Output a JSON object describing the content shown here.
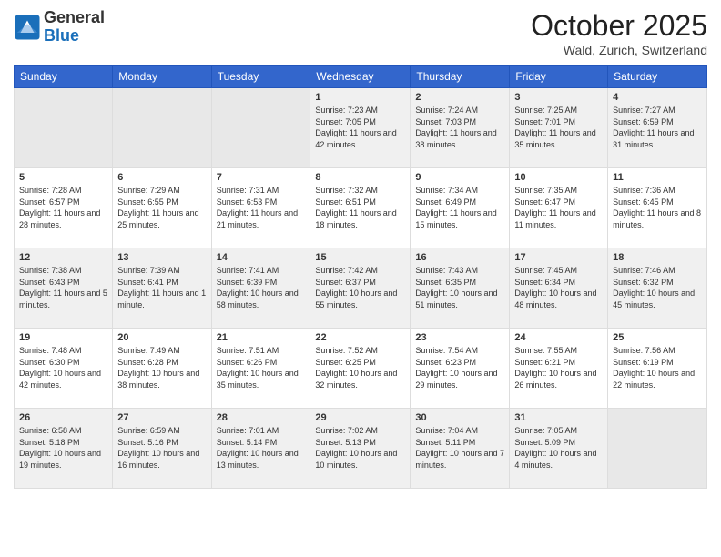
{
  "header": {
    "logo_general": "General",
    "logo_blue": "Blue",
    "month_title": "October 2025",
    "location": "Wald, Zurich, Switzerland"
  },
  "weekdays": [
    "Sunday",
    "Monday",
    "Tuesday",
    "Wednesday",
    "Thursday",
    "Friday",
    "Saturday"
  ],
  "weeks": [
    [
      {
        "day": "",
        "sunrise": "",
        "sunset": "",
        "daylight": ""
      },
      {
        "day": "",
        "sunrise": "",
        "sunset": "",
        "daylight": ""
      },
      {
        "day": "",
        "sunrise": "",
        "sunset": "",
        "daylight": ""
      },
      {
        "day": "1",
        "sunrise": "Sunrise: 7:23 AM",
        "sunset": "Sunset: 7:05 PM",
        "daylight": "Daylight: 11 hours and 42 minutes."
      },
      {
        "day": "2",
        "sunrise": "Sunrise: 7:24 AM",
        "sunset": "Sunset: 7:03 PM",
        "daylight": "Daylight: 11 hours and 38 minutes."
      },
      {
        "day": "3",
        "sunrise": "Sunrise: 7:25 AM",
        "sunset": "Sunset: 7:01 PM",
        "daylight": "Daylight: 11 hours and 35 minutes."
      },
      {
        "day": "4",
        "sunrise": "Sunrise: 7:27 AM",
        "sunset": "Sunset: 6:59 PM",
        "daylight": "Daylight: 11 hours and 31 minutes."
      }
    ],
    [
      {
        "day": "5",
        "sunrise": "Sunrise: 7:28 AM",
        "sunset": "Sunset: 6:57 PM",
        "daylight": "Daylight: 11 hours and 28 minutes."
      },
      {
        "day": "6",
        "sunrise": "Sunrise: 7:29 AM",
        "sunset": "Sunset: 6:55 PM",
        "daylight": "Daylight: 11 hours and 25 minutes."
      },
      {
        "day": "7",
        "sunrise": "Sunrise: 7:31 AM",
        "sunset": "Sunset: 6:53 PM",
        "daylight": "Daylight: 11 hours and 21 minutes."
      },
      {
        "day": "8",
        "sunrise": "Sunrise: 7:32 AM",
        "sunset": "Sunset: 6:51 PM",
        "daylight": "Daylight: 11 hours and 18 minutes."
      },
      {
        "day": "9",
        "sunrise": "Sunrise: 7:34 AM",
        "sunset": "Sunset: 6:49 PM",
        "daylight": "Daylight: 11 hours and 15 minutes."
      },
      {
        "day": "10",
        "sunrise": "Sunrise: 7:35 AM",
        "sunset": "Sunset: 6:47 PM",
        "daylight": "Daylight: 11 hours and 11 minutes."
      },
      {
        "day": "11",
        "sunrise": "Sunrise: 7:36 AM",
        "sunset": "Sunset: 6:45 PM",
        "daylight": "Daylight: 11 hours and 8 minutes."
      }
    ],
    [
      {
        "day": "12",
        "sunrise": "Sunrise: 7:38 AM",
        "sunset": "Sunset: 6:43 PM",
        "daylight": "Daylight: 11 hours and 5 minutes."
      },
      {
        "day": "13",
        "sunrise": "Sunrise: 7:39 AM",
        "sunset": "Sunset: 6:41 PM",
        "daylight": "Daylight: 11 hours and 1 minute."
      },
      {
        "day": "14",
        "sunrise": "Sunrise: 7:41 AM",
        "sunset": "Sunset: 6:39 PM",
        "daylight": "Daylight: 10 hours and 58 minutes."
      },
      {
        "day": "15",
        "sunrise": "Sunrise: 7:42 AM",
        "sunset": "Sunset: 6:37 PM",
        "daylight": "Daylight: 10 hours and 55 minutes."
      },
      {
        "day": "16",
        "sunrise": "Sunrise: 7:43 AM",
        "sunset": "Sunset: 6:35 PM",
        "daylight": "Daylight: 10 hours and 51 minutes."
      },
      {
        "day": "17",
        "sunrise": "Sunrise: 7:45 AM",
        "sunset": "Sunset: 6:34 PM",
        "daylight": "Daylight: 10 hours and 48 minutes."
      },
      {
        "day": "18",
        "sunrise": "Sunrise: 7:46 AM",
        "sunset": "Sunset: 6:32 PM",
        "daylight": "Daylight: 10 hours and 45 minutes."
      }
    ],
    [
      {
        "day": "19",
        "sunrise": "Sunrise: 7:48 AM",
        "sunset": "Sunset: 6:30 PM",
        "daylight": "Daylight: 10 hours and 42 minutes."
      },
      {
        "day": "20",
        "sunrise": "Sunrise: 7:49 AM",
        "sunset": "Sunset: 6:28 PM",
        "daylight": "Daylight: 10 hours and 38 minutes."
      },
      {
        "day": "21",
        "sunrise": "Sunrise: 7:51 AM",
        "sunset": "Sunset: 6:26 PM",
        "daylight": "Daylight: 10 hours and 35 minutes."
      },
      {
        "day": "22",
        "sunrise": "Sunrise: 7:52 AM",
        "sunset": "Sunset: 6:25 PM",
        "daylight": "Daylight: 10 hours and 32 minutes."
      },
      {
        "day": "23",
        "sunrise": "Sunrise: 7:54 AM",
        "sunset": "Sunset: 6:23 PM",
        "daylight": "Daylight: 10 hours and 29 minutes."
      },
      {
        "day": "24",
        "sunrise": "Sunrise: 7:55 AM",
        "sunset": "Sunset: 6:21 PM",
        "daylight": "Daylight: 10 hours and 26 minutes."
      },
      {
        "day": "25",
        "sunrise": "Sunrise: 7:56 AM",
        "sunset": "Sunset: 6:19 PM",
        "daylight": "Daylight: 10 hours and 22 minutes."
      }
    ],
    [
      {
        "day": "26",
        "sunrise": "Sunrise: 6:58 AM",
        "sunset": "Sunset: 5:18 PM",
        "daylight": "Daylight: 10 hours and 19 minutes."
      },
      {
        "day": "27",
        "sunrise": "Sunrise: 6:59 AM",
        "sunset": "Sunset: 5:16 PM",
        "daylight": "Daylight: 10 hours and 16 minutes."
      },
      {
        "day": "28",
        "sunrise": "Sunrise: 7:01 AM",
        "sunset": "Sunset: 5:14 PM",
        "daylight": "Daylight: 10 hours and 13 minutes."
      },
      {
        "day": "29",
        "sunrise": "Sunrise: 7:02 AM",
        "sunset": "Sunset: 5:13 PM",
        "daylight": "Daylight: 10 hours and 10 minutes."
      },
      {
        "day": "30",
        "sunrise": "Sunrise: 7:04 AM",
        "sunset": "Sunset: 5:11 PM",
        "daylight": "Daylight: 10 hours and 7 minutes."
      },
      {
        "day": "31",
        "sunrise": "Sunrise: 7:05 AM",
        "sunset": "Sunset: 5:09 PM",
        "daylight": "Daylight: 10 hours and 4 minutes."
      },
      {
        "day": "",
        "sunrise": "",
        "sunset": "",
        "daylight": ""
      }
    ]
  ]
}
